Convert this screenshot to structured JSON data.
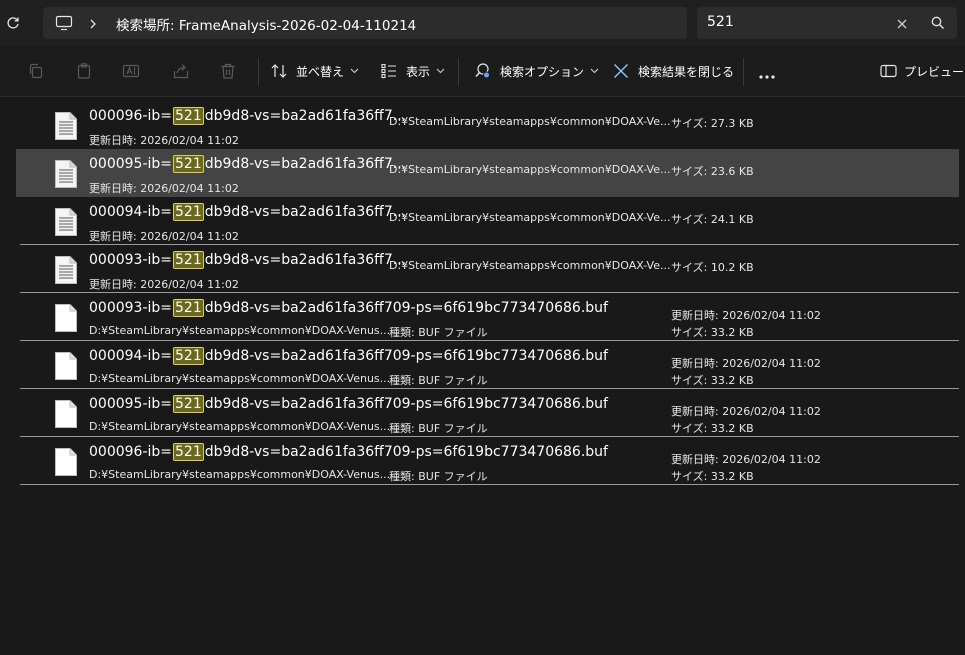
{
  "address_bar": {
    "location": "検索場所: FrameAnalysis-2026-02-04-110214"
  },
  "search": {
    "query": "521"
  },
  "toolbar": {
    "sort_label": "並べ替え",
    "view_label": "表示",
    "search_options_label": "検索オプション",
    "close_search_label": "検索結果を閉じる",
    "preview_label": "プレビュー"
  },
  "colors": {
    "background": "#191919",
    "selected_row": "#444444",
    "highlight_fill": "#6b6a1c",
    "highlight_border": "#d8d34a",
    "close_search_icon": "#8ec7ff"
  },
  "results": [
    {
      "name_prefix": "000096-ib=",
      "name_match": "521",
      "name_suffix": "db9d8-vs=ba2ad61fa36ff7...",
      "icon": "text-document-icon",
      "layout": "A",
      "date_label": "更新日時:",
      "date": "2026/02/04 11:02",
      "path": "D:¥SteamLibrary¥steamapps¥common¥DOAX-Ve...",
      "size_label": "サイズ:",
      "size": "27.3 KB",
      "selected": false
    },
    {
      "name_prefix": "000095-ib=",
      "name_match": "521",
      "name_suffix": "db9d8-vs=ba2ad61fa36ff7...",
      "icon": "text-document-icon",
      "layout": "A",
      "date_label": "更新日時:",
      "date": "2026/02/04 11:02",
      "path": "D:¥SteamLibrary¥steamapps¥common¥DOAX-Ve...",
      "size_label": "サイズ:",
      "size": "23.6 KB",
      "selected": true
    },
    {
      "name_prefix": "000094-ib=",
      "name_match": "521",
      "name_suffix": "db9d8-vs=ba2ad61fa36ff7...",
      "icon": "text-document-icon",
      "layout": "A",
      "date_label": "更新日時:",
      "date": "2026/02/04 11:02",
      "path": "D:¥SteamLibrary¥steamapps¥common¥DOAX-Ve...",
      "size_label": "サイズ:",
      "size": "24.1 KB",
      "selected": false
    },
    {
      "name_prefix": "000093-ib=",
      "name_match": "521",
      "name_suffix": "db9d8-vs=ba2ad61fa36ff7...",
      "icon": "text-document-icon",
      "layout": "A",
      "date_label": "更新日時:",
      "date": "2026/02/04 11:02",
      "path": "D:¥SteamLibrary¥steamapps¥common¥DOAX-Ve...",
      "size_label": "サイズ:",
      "size": "10.2 KB",
      "selected": false
    },
    {
      "name_prefix": "000093-ib=",
      "name_match": "521",
      "name_suffix": "db9d8-vs=ba2ad61fa36ff709-ps=6f619bc773470686.buf",
      "icon": "blank-file-icon",
      "layout": "B",
      "path": "D:¥SteamLibrary¥steamapps¥common¥DOAX-Venus...",
      "type_label": "種類:",
      "type": "BUF ファイル",
      "date_label": "更新日時:",
      "date": "2026/02/04 11:02",
      "size_label": "サイズ:",
      "size": "33.2 KB",
      "selected": false
    },
    {
      "name_prefix": "000094-ib=",
      "name_match": "521",
      "name_suffix": "db9d8-vs=ba2ad61fa36ff709-ps=6f619bc773470686.buf",
      "icon": "blank-file-icon",
      "layout": "B",
      "path": "D:¥SteamLibrary¥steamapps¥common¥DOAX-Venus...",
      "type_label": "種類:",
      "type": "BUF ファイル",
      "date_label": "更新日時:",
      "date": "2026/02/04 11:02",
      "size_label": "サイズ:",
      "size": "33.2 KB",
      "selected": false
    },
    {
      "name_prefix": "000095-ib=",
      "name_match": "521",
      "name_suffix": "db9d8-vs=ba2ad61fa36ff709-ps=6f619bc773470686.buf",
      "icon": "blank-file-icon",
      "layout": "B",
      "path": "D:¥SteamLibrary¥steamapps¥common¥DOAX-Venus...",
      "type_label": "種類:",
      "type": "BUF ファイル",
      "date_label": "更新日時:",
      "date": "2026/02/04 11:02",
      "size_label": "サイズ:",
      "size": "33.2 KB",
      "selected": false
    },
    {
      "name_prefix": "000096-ib=",
      "name_match": "521",
      "name_suffix": "db9d8-vs=ba2ad61fa36ff709-ps=6f619bc773470686.buf",
      "icon": "blank-file-icon",
      "layout": "B",
      "path": "D:¥SteamLibrary¥steamapps¥common¥DOAX-Venus...",
      "type_label": "種類:",
      "type": "BUF ファイル",
      "date_label": "更新日時:",
      "date": "2026/02/04 11:02",
      "size_label": "サイズ:",
      "size": "33.2 KB",
      "selected": false
    }
  ]
}
